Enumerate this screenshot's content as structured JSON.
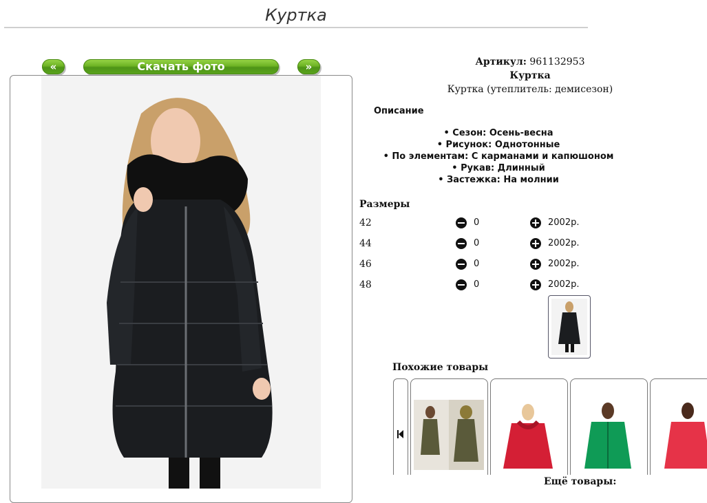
{
  "page": {
    "title": "Куртка"
  },
  "toolbar": {
    "prev_label": "«",
    "download_label": "Скачать фото",
    "next_label": "»"
  },
  "product": {
    "article_label": "Артикул:",
    "article_value": "961132953",
    "name": "Куртка",
    "description": "Куртка (утеплитель: демисезон)"
  },
  "description": {
    "heading": "Описание",
    "features": [
      "• Сезон: Осень-весна",
      "• Рисунок: Однотонные",
      "• По элементам: С карманами и капюшоном",
      "• Рукав: Длинный",
      "• Застежка: На молнии"
    ]
  },
  "sizes": {
    "heading": "Размеры",
    "rows": [
      {
        "size": "42",
        "qty": "0",
        "price": "2002р."
      },
      {
        "size": "44",
        "qty": "0",
        "price": "2002р."
      },
      {
        "size": "46",
        "qty": "0",
        "price": "2002р."
      },
      {
        "size": "48",
        "qty": "0",
        "price": "2002р."
      }
    ]
  },
  "similar": {
    "heading": "Похожие товары",
    "more_label": "Ещё товары:"
  },
  "colors": {
    "accent": "#6db324",
    "coat_black": "#1b1d20",
    "coat_olive": "#5a5a3a",
    "coat_red": "#d41f35",
    "coat_green": "#0f9b56",
    "coat_coral": "#e63348"
  },
  "icons": {
    "minus": "minus-circle-icon",
    "plus": "plus-circle-icon",
    "first": "first-page-icon"
  }
}
